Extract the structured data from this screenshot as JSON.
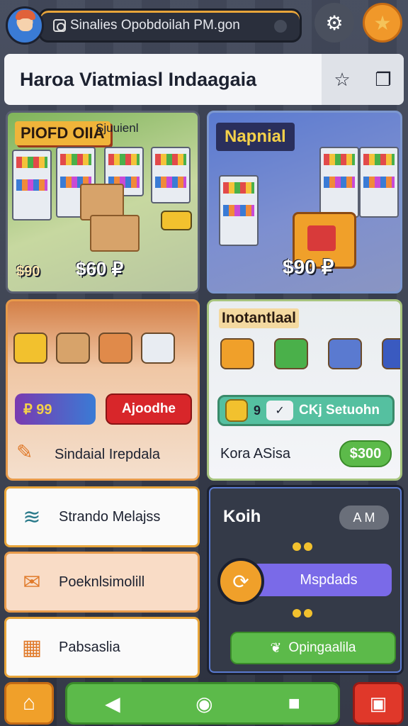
{
  "topbar": {
    "search_text": "Sinalies Opobdoilah PM.gon",
    "icons": [
      "avatar",
      "search-icon",
      "mic-icon",
      "gear-icon",
      "star-icon"
    ]
  },
  "header": {
    "title": "Haroa Viatmiasl Indaagaia",
    "icons": [
      "star-outline-icon",
      "copy-icon"
    ]
  },
  "card_a": {
    "label": "PIOFD OIIA",
    "sub": "Sjuuienl",
    "price_small": "$90",
    "price_main": "$60 ₽"
  },
  "card_b": {
    "label": "Napnial",
    "price": "$90 ₽"
  },
  "card_c": {
    "pill_a": "₽ 99",
    "pill_b": "Ajoodhe",
    "row_text": "Sindaial Irepdala"
  },
  "card_d": {
    "title": "Inotantlaal",
    "bar_num": "9",
    "bar_tile": "✓",
    "bar_text": "CKj Setuohn",
    "foot": "Kora ASisa",
    "badge": "$300"
  },
  "list": [
    {
      "label": "Strando Melajss",
      "icon": "wifi-shell-icon"
    },
    {
      "label": "Poeknlsimolill",
      "icon": "ticket-icon"
    },
    {
      "label": "Pabsaslia",
      "icon": "calendar-icon"
    }
  ],
  "dark_panel": {
    "title": "Koih",
    "badge": "A M",
    "purple_btn": "Mspdads",
    "green_btn": "Opingaalila"
  },
  "colors": {
    "accent_orange": "#f0a02a",
    "accent_green": "#5cba4a",
    "accent_red": "#e0382a",
    "accent_purple": "#7a6ae8"
  }
}
